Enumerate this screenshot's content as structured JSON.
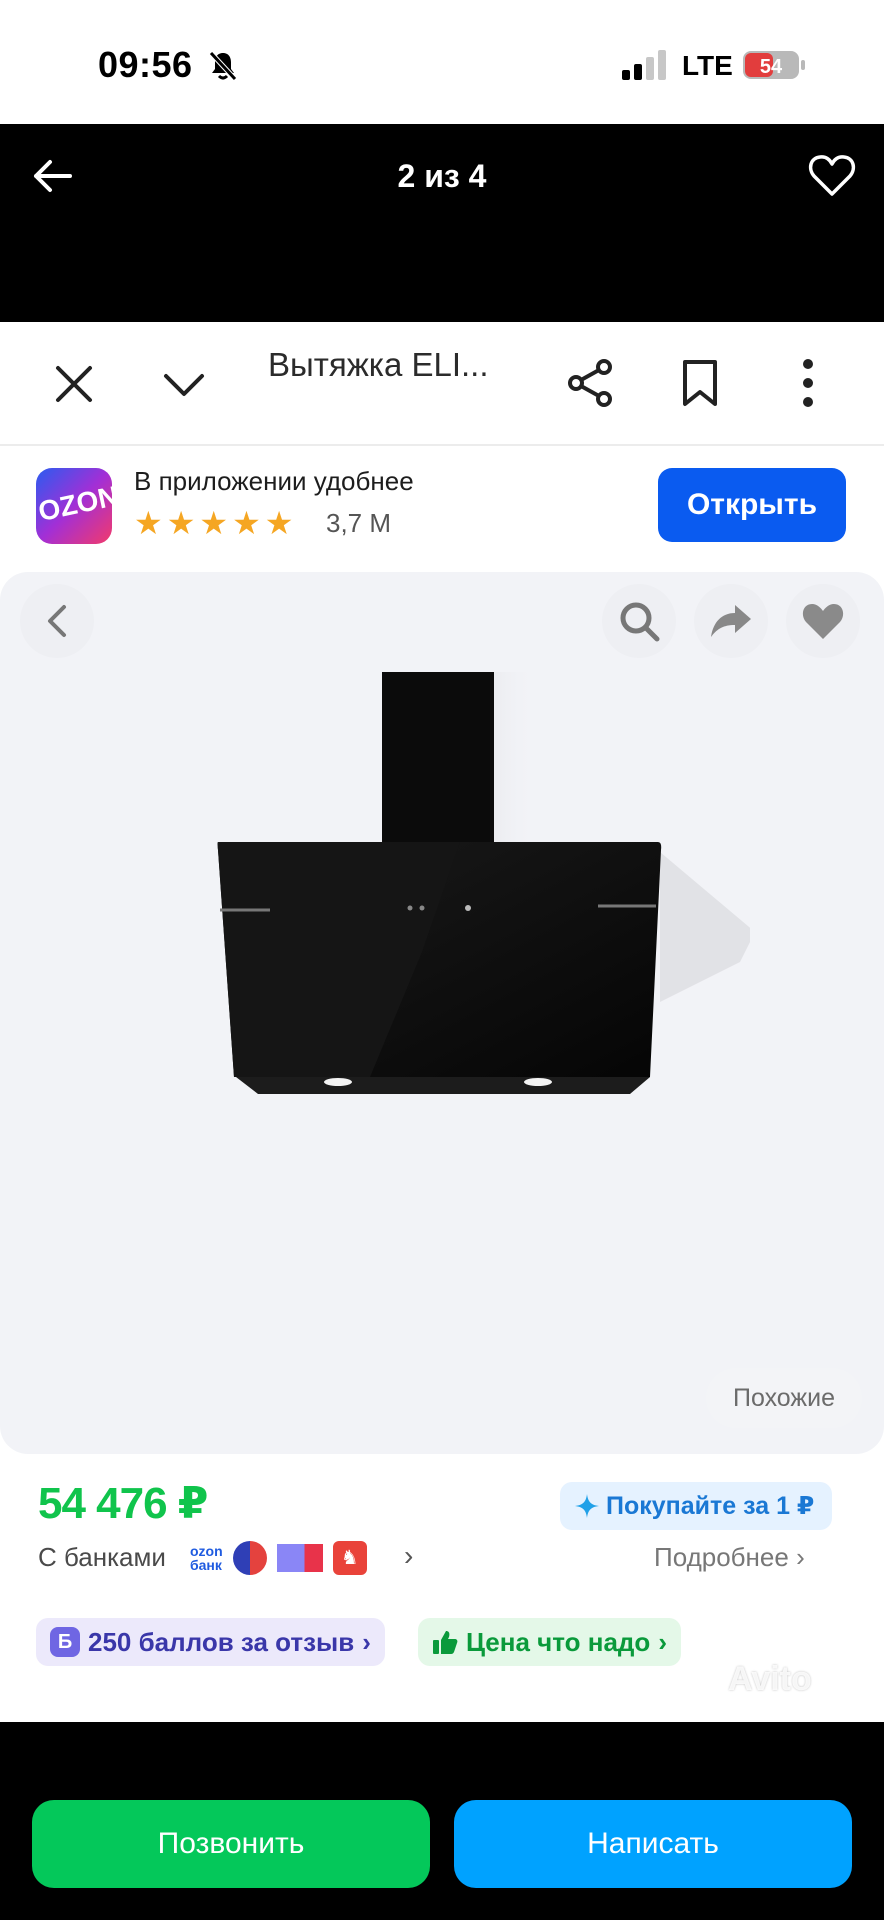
{
  "status_bar": {
    "time": "09:56",
    "network": "LTE",
    "battery": "54"
  },
  "header": {
    "title": "2 из 4"
  },
  "photo": {
    "browser": {
      "title": "Вытяжка ELI..."
    },
    "promo": {
      "logo_text": "OZON",
      "text": "В приложении удобнее",
      "rating": "3,7 М",
      "stars": 5,
      "open_button": "Открыть"
    },
    "gallery": {
      "similar_button": "Похожие"
    },
    "price": "54 476 ₽",
    "buy_for_one": "Покупайте за 1 ₽",
    "banks_label": "С банками",
    "ozonbank_line1": "ozon",
    "ozonbank_line2": "банк",
    "more_link": "Подробнее",
    "points_chip": "250 баллов за отзыв",
    "points_badge": "Б",
    "price_chip": "Цена что надо",
    "watermark": "Avito"
  },
  "actions": {
    "call": "Позвонить",
    "write": "Написать"
  },
  "colors": {
    "call_button": "#04c85a",
    "write_button": "#00a2ff",
    "price": "#10c44c",
    "ozon_open_button": "#0a5bf0"
  }
}
